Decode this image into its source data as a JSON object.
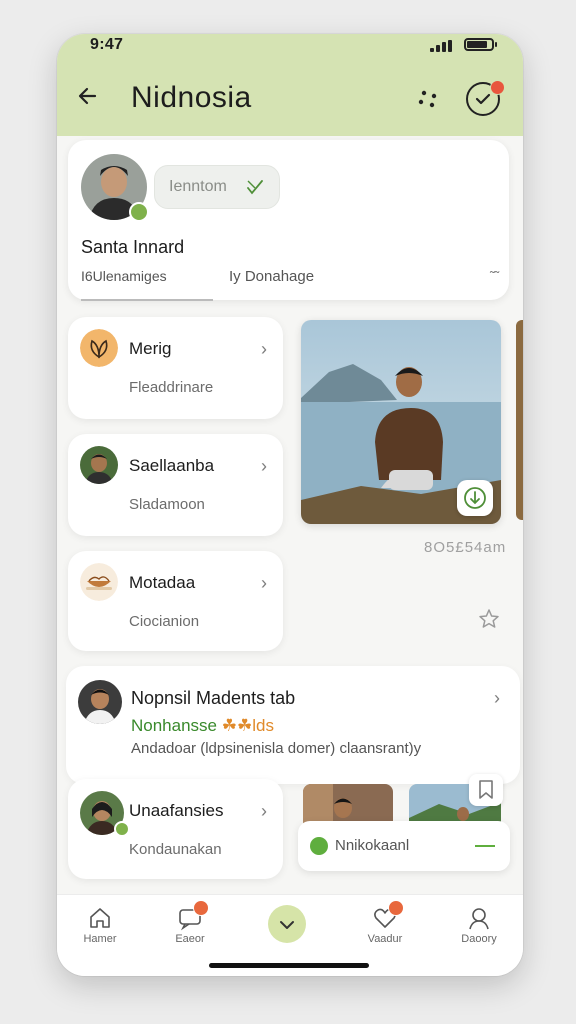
{
  "status_bar": {
    "time": "9:47"
  },
  "header": {
    "title": "Nidnosia"
  },
  "profile": {
    "name": "Santa Innard",
    "action_label": "Ienntom",
    "stat_left": "I6Ulenamiges",
    "stat_right": "Iy Donahage",
    "more_label": "˜˜"
  },
  "cards": [
    {
      "title": "Merig",
      "subtitle": "Fleaddrinare"
    },
    {
      "title": "Saellaanba",
      "subtitle": "Sladamoon"
    },
    {
      "title": "Motadaa",
      "subtitle": "Ciocianion"
    },
    {
      "title": "Unaafansies",
      "subtitle": "Kondaunakan"
    }
  ],
  "photo": {
    "caption": "8O5£54am"
  },
  "feature": {
    "title": "Nopnsil Madents tab",
    "tag_green": "Nonhansse",
    "tag_orange": "☘☘lds",
    "description": "Andadoar (ldpsinenisla domer) claansrant)y"
  },
  "pill": {
    "label": "Nnikokaanl"
  },
  "nav": [
    {
      "label": "Hamer",
      "has_badge": false
    },
    {
      "label": "Eaeor",
      "has_badge": true
    },
    {
      "label": "",
      "has_badge": false
    },
    {
      "label": "Vaadur",
      "has_badge": true
    },
    {
      "label": "Daoory",
      "has_badge": false
    }
  ],
  "colors": {
    "header_bg": "#d5e3b3",
    "accent_green": "#5fae3e",
    "badge_red": "#e8563d",
    "tag_orange": "#e08a2a"
  }
}
